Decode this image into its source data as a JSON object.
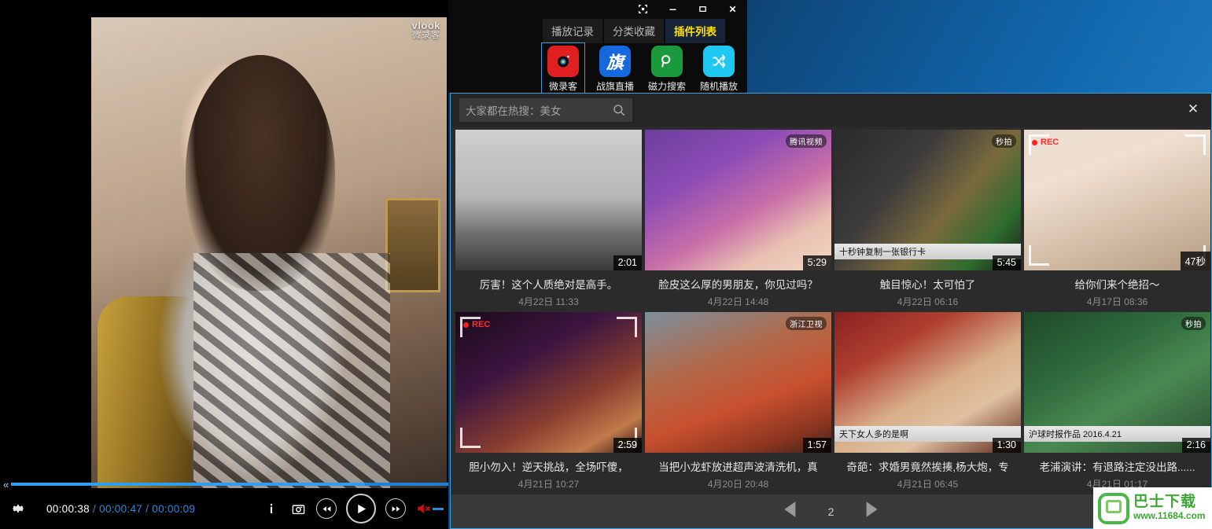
{
  "desktop": {
    "logo_name": "windows-logo",
    "logo_colors": [
      "#2f2f2f",
      "#2f9ee0",
      "#bdbdbd",
      "#f2f2f2",
      "#f2d21a",
      "#2f7ed8"
    ]
  },
  "player": {
    "watermark": {
      "en": "vlook",
      "cn": "微录客"
    },
    "time": {
      "current": "00:00:38",
      "separator": "/",
      "total": "00:00:47",
      "remaining": "00:00:09",
      "full": "00:00:38 / 00:00:47 / 00:00:09"
    },
    "progress_percent": 81,
    "collapse_label": "«",
    "controls": {
      "settings": "settings-gear",
      "info": "i",
      "snapshot": "camera",
      "rewind": "◀◀",
      "play": "▶",
      "forward": "▶▶",
      "mute": "muted"
    }
  },
  "plugin_window": {
    "window_buttons": [
      {
        "name": "restore-window-button",
        "glyph": "⛶"
      },
      {
        "name": "minimize-button",
        "glyph": "—"
      },
      {
        "name": "maximize-button",
        "glyph": "▢"
      },
      {
        "name": "close-button",
        "glyph": "✕"
      }
    ],
    "tabs": [
      {
        "label": "播放记录",
        "active": false
      },
      {
        "label": "分类收藏",
        "active": false
      },
      {
        "label": "插件列表",
        "active": true
      }
    ],
    "plugins": [
      {
        "label": "微录客",
        "glyph": "◎",
        "bg": "#e02020",
        "selected": true
      },
      {
        "label": "战旗直播",
        "glyph": "旗",
        "bg": "#1569dd",
        "selected": false
      },
      {
        "label": "磁力搜索",
        "glyph": "⌕",
        "bg": "#1a9a3c",
        "selected": false
      },
      {
        "label": "随机播放",
        "glyph": "⤫",
        "bg": "#1ec8f0",
        "selected": false
      }
    ]
  },
  "browse": {
    "search": {
      "placeholder": "大家都在热搜：美女",
      "icon": "search-icon"
    },
    "close_glyph": "✕",
    "pager": {
      "prev": "◀",
      "page": "2",
      "next": "▶"
    },
    "videos": [
      {
        "title": "厉害！这个人质绝对是高手。",
        "date": "4月22日  11:33",
        "duration": "2:01",
        "badge": "",
        "caption": "",
        "rec": false,
        "art": "linear-gradient(180deg,#cfcfcf 0%,#b6b6b6 48%,#6f6f6f 74%,#3a3a3a 100%)"
      },
      {
        "title": "脸皮这么厚的男朋友，你见过吗？",
        "date": "4月22日  14:48",
        "duration": "5:29",
        "badge": "腾讯视频",
        "caption": "",
        "rec": false,
        "art": "linear-gradient(150deg,#6d3f9e 0%,#8a4bb5 30%,#c96fa8 58%,#e8c0b0 78%,#f1d7c6 100%)"
      },
      {
        "title": "触目惊心！太可怕了",
        "date": "4月22日  06:16",
        "duration": "5:45",
        "badge": "秒拍",
        "caption": "十秒钟复制一张银行卡",
        "rec": false,
        "art": "linear-gradient(130deg,#2a2a2a 0%,#3c3c3c 35%,#7a6a3c 60%,#2d6b2d 82%,#1a1a1a 100%)"
      },
      {
        "title": "给你们来个绝招～",
        "date": "4月17日  08:36",
        "duration": "47秒",
        "badge": "",
        "caption": "",
        "rec": true,
        "art": "linear-gradient(160deg,#e9ddd0 0%,#f0dfd2 30%,#d8c3ae 60%,#b59d84 100%)"
      },
      {
        "title": "胆小勿入！逆天挑战，全场吓傻，",
        "date": "4月21日  10:27",
        "duration": "2:59",
        "badge": "",
        "caption": "",
        "rec": true,
        "art": "linear-gradient(150deg,#1a0a18 0%,#3d1540 35%,#8a3f2f 65%,#c07a4a 85%,#2a1010 100%)"
      },
      {
        "title": "当把小龙虾放进超声波清洗机，真",
        "date": "4月20日  20:48",
        "duration": "1:57",
        "badge": "浙江卫视",
        "caption": "",
        "rec": false,
        "art": "linear-gradient(160deg,#7c8f9e 0%,#b06a4a 35%,#c8502f 62%,#8a3520 85%,#3a2218 100%)"
      },
      {
        "title": "奇葩：求婚男竟然挨揍,杨大炮，专",
        "date": "4月21日  06:45",
        "duration": "1:30",
        "badge": "",
        "caption": "天下女人多的是啊",
        "rec": false,
        "art": "linear-gradient(150deg,#8a2020 0%,#b04030 28%,#d8b08a 55%,#e0c0a0 72%,#5a2418 100%)"
      },
      {
        "title": "老浦演讲：有退路注定没出路......",
        "date": "4月21日  01:17",
        "duration": "2:16",
        "badge": "秒拍",
        "caption": "沪球时报作品   2016.4.21",
        "rec": false,
        "art": "linear-gradient(150deg,#1e4a2a 0%,#2f6a3c 35%,#4a8a52 60%,#2a4a30 100%)"
      }
    ]
  },
  "download_watermark": {
    "cn": "巴士下载",
    "url": "www.11684.com",
    "logo_name": "bus-download-logo"
  }
}
